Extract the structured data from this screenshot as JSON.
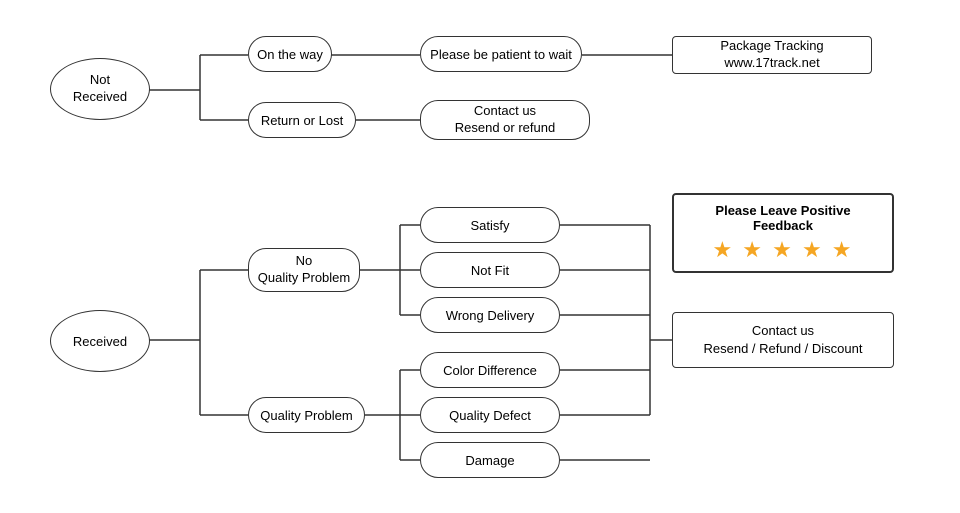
{
  "nodes": {
    "not_received": {
      "label": "Not\nReceived"
    },
    "on_the_way": {
      "label": "On the way"
    },
    "return_or_lost": {
      "label": "Return or Lost"
    },
    "patient_wait": {
      "label": "Please be patient to wait"
    },
    "contact_resend_refund": {
      "label": "Contact us\nResend or refund"
    },
    "package_tracking": {
      "label": "Package Tracking\nwww.17track.net"
    },
    "received": {
      "label": "Received"
    },
    "no_quality_problem": {
      "label": "No\nQuality Problem"
    },
    "quality_problem": {
      "label": "Quality Problem"
    },
    "satisfy": {
      "label": "Satisfy"
    },
    "not_fit": {
      "label": "Not Fit"
    },
    "wrong_delivery": {
      "label": "Wrong Delivery"
    },
    "color_difference": {
      "label": "Color Difference"
    },
    "quality_defect": {
      "label": "Quality Defect"
    },
    "damage": {
      "label": "Damage"
    },
    "feedback": {
      "label": "Please Leave Positive Feedback"
    },
    "feedback_stars": {
      "label": "★ ★ ★ ★ ★"
    },
    "contact_resend_refund_discount": {
      "label": "Contact us\nResend / Refund / Discount"
    }
  }
}
